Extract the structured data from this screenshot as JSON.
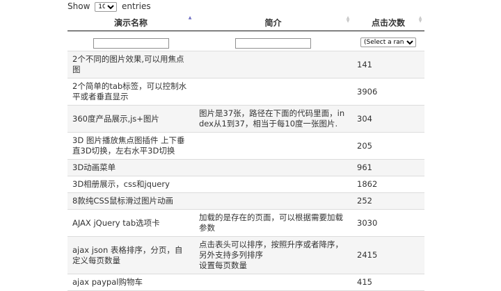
{
  "length_menu": {
    "prefix": "Show",
    "selected": "10",
    "suffix": "entries"
  },
  "columns": [
    {
      "label": "演示名称",
      "sort_state": "asc"
    },
    {
      "label": "简介",
      "sort_state": "both"
    },
    {
      "label": "点击次数",
      "sort_state": "both"
    }
  ],
  "filters": {
    "name_value": "",
    "desc_value": "",
    "clicks_select": "(Select a range)"
  },
  "rows": [
    {
      "name": "2个不同的图片效果,可以用焦点图",
      "desc": "",
      "clicks": "141"
    },
    {
      "name": "2个简单的tab标签，可以控制水平或者垂直显示",
      "desc": "",
      "clicks": "3906"
    },
    {
      "name": "360度产品展示,js+图片",
      "desc": "图片是37张，路径在下面的代码里面，index从1到37，相当于每10度一张图片.",
      "clicks": "304"
    },
    {
      "name": "3D 图片播放焦点图插件 上下垂直3D切换，左右水平3D切换",
      "desc": "",
      "clicks": "205"
    },
    {
      "name": "3D动画菜单",
      "desc": "",
      "clicks": "961"
    },
    {
      "name": "3D相册展示，css和jquery",
      "desc": "",
      "clicks": "1862"
    },
    {
      "name": "8款纯CSS鼠标滑过图片动画",
      "desc": "",
      "clicks": "252"
    },
    {
      "name": "AJAX jQuery tab选项卡",
      "desc": " 加载的是存在的页面，可以根据需要加载参数",
      "clicks": "3030"
    },
    {
      "name": "ajax json 表格排序，分页，自定义每页数量",
      "desc": " 点击表头可以排序，按照升序或者降序，另外支持多列排序\n设置每页数量",
      "clicks": "2415"
    },
    {
      "name": "ajax paypal购物车",
      "desc": "",
      "clicks": "415"
    }
  ]
}
